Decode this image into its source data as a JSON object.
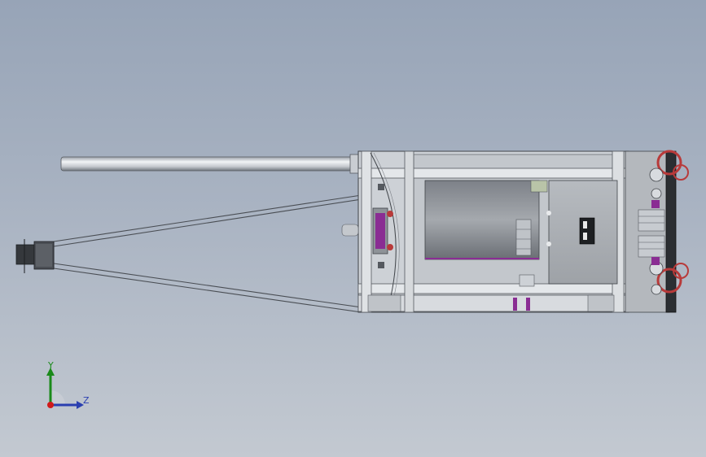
{
  "viewport": {
    "background_top": "#97a4b7",
    "background_bottom": "#c3c9d1"
  },
  "model": {
    "accent_magenta": "#8a2d93",
    "accent_red": "#b83a3a",
    "frame_color": "#d4d8dd",
    "panel_color": "#a7abb0"
  },
  "triad": {
    "y_label": "Y",
    "z_label": "Z",
    "y_color": "#1a8a1a",
    "z_color": "#2a3fb0",
    "x_color": "#d01a1a"
  }
}
